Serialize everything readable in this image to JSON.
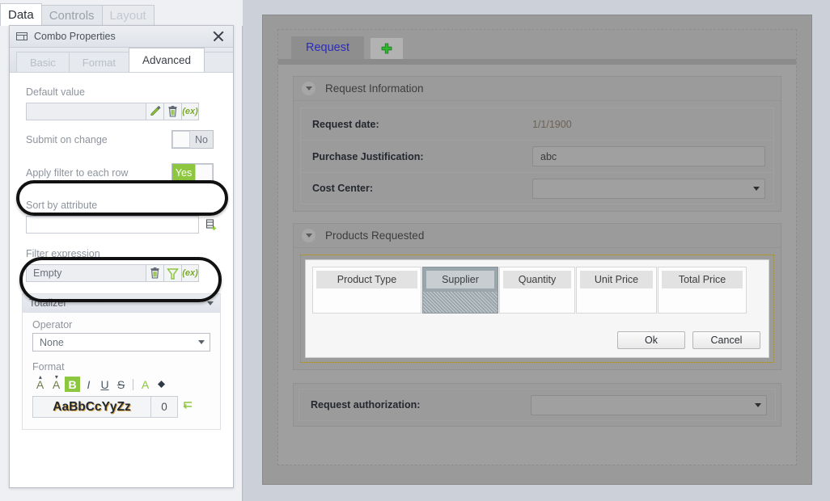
{
  "outer_tabs": [
    {
      "label": "Data",
      "state": "active"
    },
    {
      "label": "Controls",
      "state": "normal"
    },
    {
      "label": "Layout",
      "state": "disabled"
    }
  ],
  "properties_window": {
    "title": "Combo Properties",
    "title_icon": "combo-box-icon",
    "close_icon": "close-icon",
    "tabs": [
      {
        "label": "Basic",
        "state": "normal"
      },
      {
        "label": "Format",
        "state": "normal"
      },
      {
        "label": "Advanced",
        "state": "active"
      }
    ],
    "default_value": {
      "label": "Default value",
      "value": "",
      "buttons": [
        {
          "icon": "pencil-icon",
          "label": ""
        },
        {
          "icon": "trash-icon",
          "label": ""
        },
        {
          "icon": "expression-icon",
          "label": "(ex)"
        }
      ]
    },
    "submit_on_change": {
      "label": "Submit on change",
      "value": "No",
      "state": "off"
    },
    "apply_filter_each_row": {
      "label": "Apply filter to each row",
      "value": "Yes",
      "state": "on"
    },
    "sort_by_attribute": {
      "label": "Sort by attribute",
      "value": "",
      "buttons": [
        {
          "icon": "add-attribute-icon",
          "label": ""
        }
      ]
    },
    "filter_expression": {
      "label": "Filter expression",
      "value": "Empty",
      "buttons": [
        {
          "icon": "trash-icon",
          "label": ""
        },
        {
          "icon": "funnel-icon",
          "label": ""
        },
        {
          "icon": "expression-icon",
          "label": "(ex)"
        }
      ]
    },
    "totalizer": {
      "title": "Totalizer",
      "collapse_icon": "caret-down-icon",
      "operator": {
        "label": "Operator",
        "value": "None"
      },
      "format": {
        "label": "Format",
        "buttons": [
          {
            "icon": "increase-font-size-icon",
            "label": "A",
            "state": "normal"
          },
          {
            "icon": "decrease-font-size-icon",
            "label": "A",
            "state": "normal"
          },
          {
            "icon": "bold-icon",
            "label": "B",
            "state": "active"
          },
          {
            "icon": "italic-icon",
            "label": "I",
            "state": "normal"
          },
          {
            "icon": "underline-icon",
            "label": "U",
            "state": "normal"
          },
          {
            "icon": "strikethrough-icon",
            "label": "S",
            "state": "normal"
          },
          {
            "icon": "text-color-icon",
            "label": "A",
            "state": "normal"
          },
          {
            "icon": "fill-color-icon",
            "label": "",
            "state": "normal"
          }
        ],
        "sample_text": "AaBbCcYyZz",
        "sample_number": "0",
        "reset_icon": "reset-format-icon"
      }
    }
  },
  "annotations": [
    {
      "name": "apply-filter-highlight",
      "shape": "ellipse",
      "color": "#111111"
    },
    {
      "name": "filter-expression-highlight",
      "shape": "ellipse",
      "color": "#111111"
    }
  ],
  "form_designer": {
    "tabs": [
      {
        "label": "Request",
        "state": "active"
      },
      {
        "label": "",
        "icon": "add-tab-plus-icon",
        "state": "add"
      }
    ],
    "sections": [
      {
        "title": "Request Information",
        "collapse_icon": "caret-down-icon",
        "rows": [
          {
            "label": "Request date:",
            "type": "text",
            "value": "1/1/1900"
          },
          {
            "label": "Purchase Justification:",
            "type": "input",
            "value": "abc"
          },
          {
            "label": "Cost Center:",
            "type": "dropdown",
            "value": ""
          }
        ]
      },
      {
        "title": "Products Requested",
        "collapse_icon": "caret-down-icon",
        "grid": {
          "columns": [
            {
              "header": "Product Type",
              "selected": false
            },
            {
              "header": "Supplier",
              "selected": true
            },
            {
              "header": "Quantity",
              "selected": false
            },
            {
              "header": "Unit Price",
              "selected": false
            },
            {
              "header": "Total Price",
              "selected": false
            }
          ],
          "rows": [],
          "buttons": [
            {
              "label": "Ok"
            },
            {
              "label": "Cancel"
            }
          ]
        }
      }
    ],
    "authorization": {
      "label": "Request authorization:",
      "type": "dropdown",
      "value": ""
    }
  },
  "colors": {
    "accent_green": "#8dc63f",
    "link_blue": "#2d2db9",
    "annotation_black": "#111111",
    "panel_bg": "#eef0f3",
    "canvas_bg": "#9a9a9a"
  }
}
